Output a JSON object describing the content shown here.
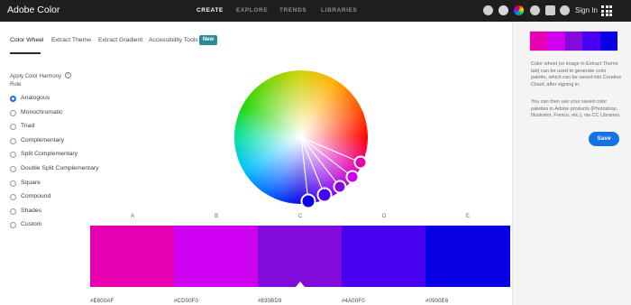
{
  "header": {
    "logo": "Adobe Color",
    "nav": [
      "CREATE",
      "EXPLORE",
      "TRENDS",
      "LIBRARIES"
    ],
    "signin": "Sign In"
  },
  "tabs": [
    {
      "label": "Color Wheel"
    },
    {
      "label": "Extract Theme"
    },
    {
      "label": "Extract Gradient"
    },
    {
      "label": "Accessibility Tools"
    }
  ],
  "new_badge": "New",
  "harmony": {
    "title": "Apply Color Harmony Rule",
    "rules": [
      "Analogous",
      "Monochromatic",
      "Triad",
      "Complementary",
      "Split Complementary",
      "Double Split Complementary",
      "Square",
      "Compound",
      "Shades",
      "Custom"
    ],
    "selected": "Analogous"
  },
  "swatches": [
    {
      "letter": "A",
      "hex": "#E600AF"
    },
    {
      "letter": "B",
      "hex": "#CD00F0"
    },
    {
      "letter": "C",
      "hex": "#830BD9"
    },
    {
      "letter": "D",
      "hex": "#4A00F0"
    },
    {
      "letter": "E",
      "hex": "#0900E6"
    }
  ],
  "side": {
    "text1": "Color wheel (or image in Extract Theme tab) can be used to generate color palette, which can be saved into Creative Cloud, after signing in.",
    "text2": "You can then use your saved color palettes in Adobe products (Photoshop, Illustrator, Fresco, etc.), via CC Libraries.",
    "save": "Save"
  }
}
